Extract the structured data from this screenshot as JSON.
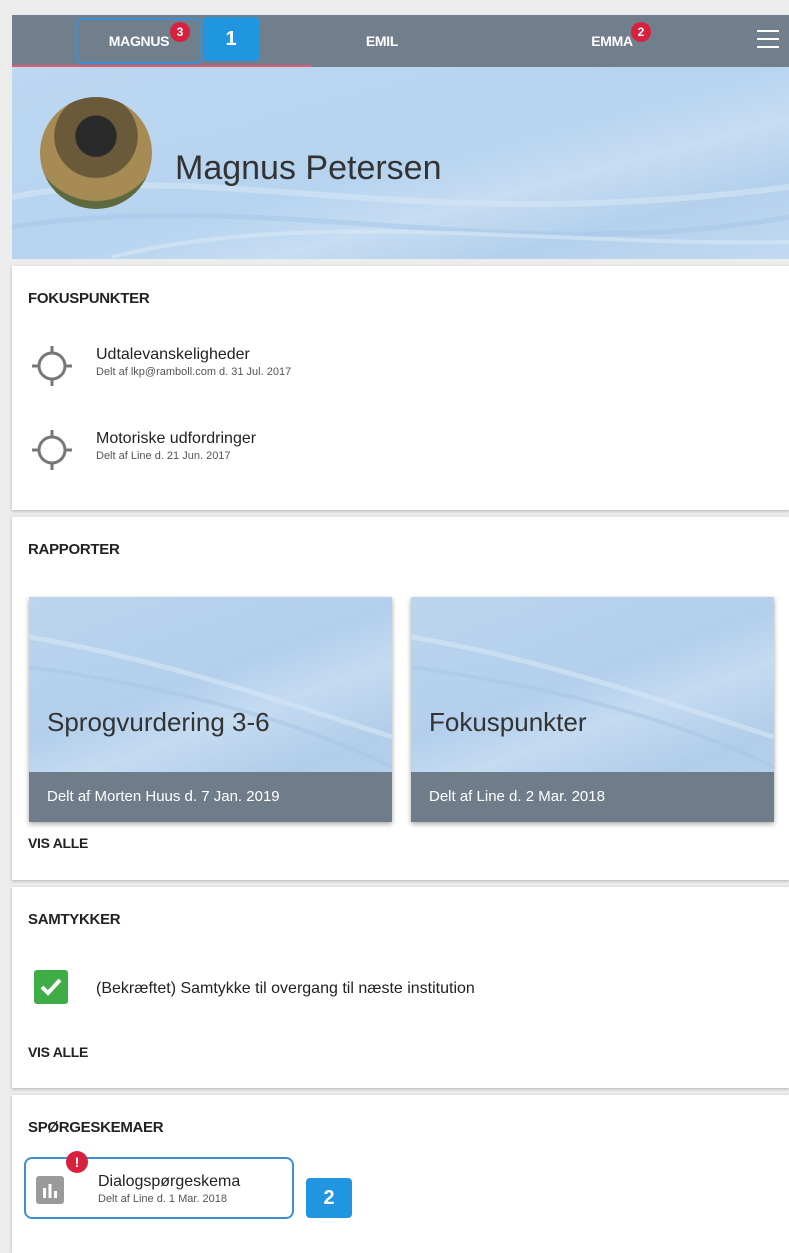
{
  "tabs": [
    {
      "label": "MAGNUS",
      "badge": "3"
    },
    {
      "label": "EMIL",
      "badge": ""
    },
    {
      "label": "EMMA",
      "badge": "2"
    }
  ],
  "callouts": {
    "first": "1",
    "second": "2"
  },
  "profile": {
    "name": "Magnus Petersen"
  },
  "fokuspunkter": {
    "title": "FOKUSPUNKTER",
    "items": [
      {
        "title": "Udtalevanskeligheder",
        "sub": "Delt af lkp@ramboll.com d. 31 Jul. 2017"
      },
      {
        "title": "Motoriske udfordringer",
        "sub": "Delt af Line d. 21 Jun. 2017"
      }
    ]
  },
  "rapporter": {
    "title": "RAPPORTER",
    "cards": [
      {
        "title": "Sprogvurdering 3-6",
        "footer": "Delt af Morten Huus d. 7 Jan. 2019"
      },
      {
        "title": "Fokuspunkter",
        "footer": "Delt af Line d. 2 Mar. 2018"
      }
    ],
    "link": "VIS ALLE"
  },
  "samtykker": {
    "title": "SAMTYKKER",
    "item": "(Bekræftet) Samtykke til overgang til næste institution",
    "link": "VIS ALLE"
  },
  "spoergeskemaer": {
    "title": "SPØRGESKEMAER",
    "item": {
      "title": "Dialogspørgeskema",
      "sub": "Delt af Line d. 1 Mar. 2018",
      "alert": "!"
    }
  },
  "colors": {
    "topbar": "#717f8d",
    "badge": "#d8213c",
    "callout": "#2196e0",
    "check": "#3fad46",
    "accent_border": "#3b91d6"
  }
}
